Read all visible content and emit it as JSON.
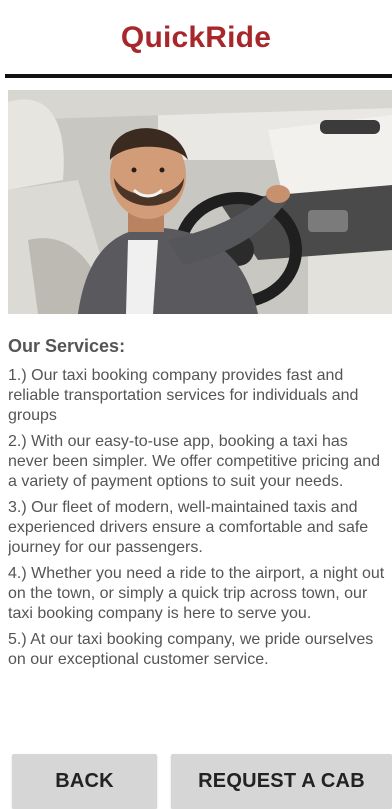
{
  "app": {
    "title": "QuickRide"
  },
  "hero_image": {
    "description_icon": "driver-photo"
  },
  "services": {
    "heading": "Our Services:",
    "items": [
      "1.) Our taxi booking company provides fast and reliable transportation services for individuals and groups",
      "2.) With our easy-to-use app, booking a taxi has never been simpler. We offer competitive pricing and a variety of payment options to suit your needs.",
      "3.) Our fleet of modern, well-maintained taxis and experienced drivers ensure a comfortable and safe journey for our passengers.",
      "4.) Whether you need a ride to the airport, a night out on the town, or simply a quick trip across town, our taxi booking company is here to serve you.",
      "5.) At our taxi booking company, we pride ourselves on our exceptional customer service."
    ]
  },
  "actions": {
    "back_label": "BACK",
    "request_label": "REQUEST A CAB"
  },
  "colors": {
    "title": "#a8272b",
    "button_bg": "#d6d6d6",
    "body_text": "#555555"
  }
}
